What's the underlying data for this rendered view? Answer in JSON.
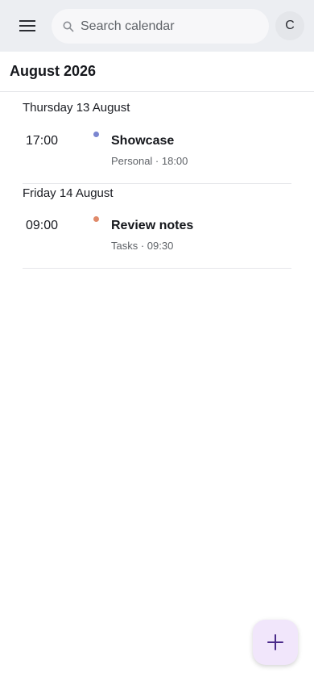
{
  "header": {
    "menu_icon": "hamburger-menu-icon",
    "search_placeholder": "Search calendar",
    "search_icon": "search-icon",
    "avatar_initial": "C"
  },
  "month": {
    "title": "August 2026"
  },
  "days": [
    {
      "label": "Thursday 13 August",
      "events": [
        {
          "time": "17:00",
          "title": "Showcase",
          "meta": "Personal · 18:00",
          "color": "#7b86d0"
        }
      ]
    },
    {
      "label": "Friday 14 August",
      "events": [
        {
          "time": "09:00",
          "title": "Review notes",
          "meta": "Tasks · 09:30",
          "color": "#e08a6a"
        }
      ]
    }
  ],
  "fab": {
    "icon": "plus-icon",
    "color": "#4a2a8a"
  }
}
